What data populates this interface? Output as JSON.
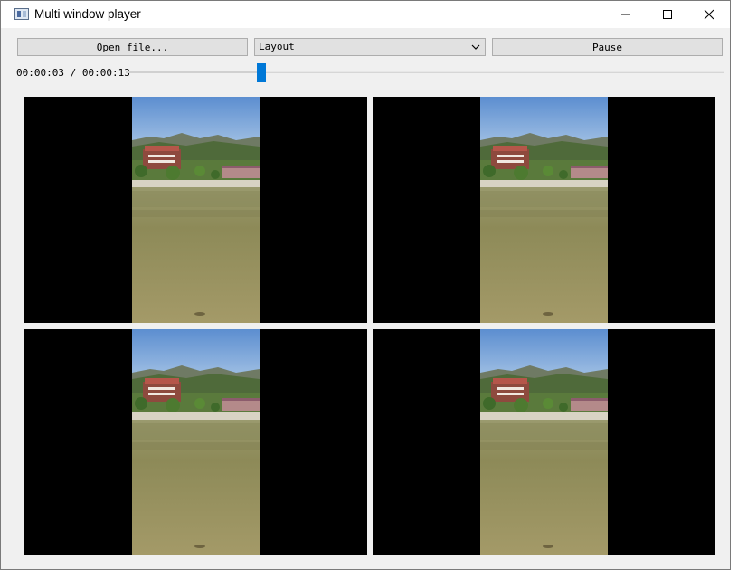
{
  "window": {
    "title": "Multi window player",
    "controls": {
      "minimize": "minimize",
      "maximize": "maximize",
      "close": "close"
    }
  },
  "toolbar": {
    "open_label": "Open file...",
    "layout_value": "Layout",
    "pause_label": "Pause"
  },
  "playback": {
    "time_text": "00:00:03 / 00:00:13",
    "position_fraction": 0.227
  },
  "videos": [
    {
      "name": "video-1"
    },
    {
      "name": "video-2"
    },
    {
      "name": "video-3"
    },
    {
      "name": "video-4"
    }
  ],
  "colors": {
    "accent": "#0078d7",
    "window_bg": "#f0f0f0",
    "video_bg": "#000000"
  }
}
